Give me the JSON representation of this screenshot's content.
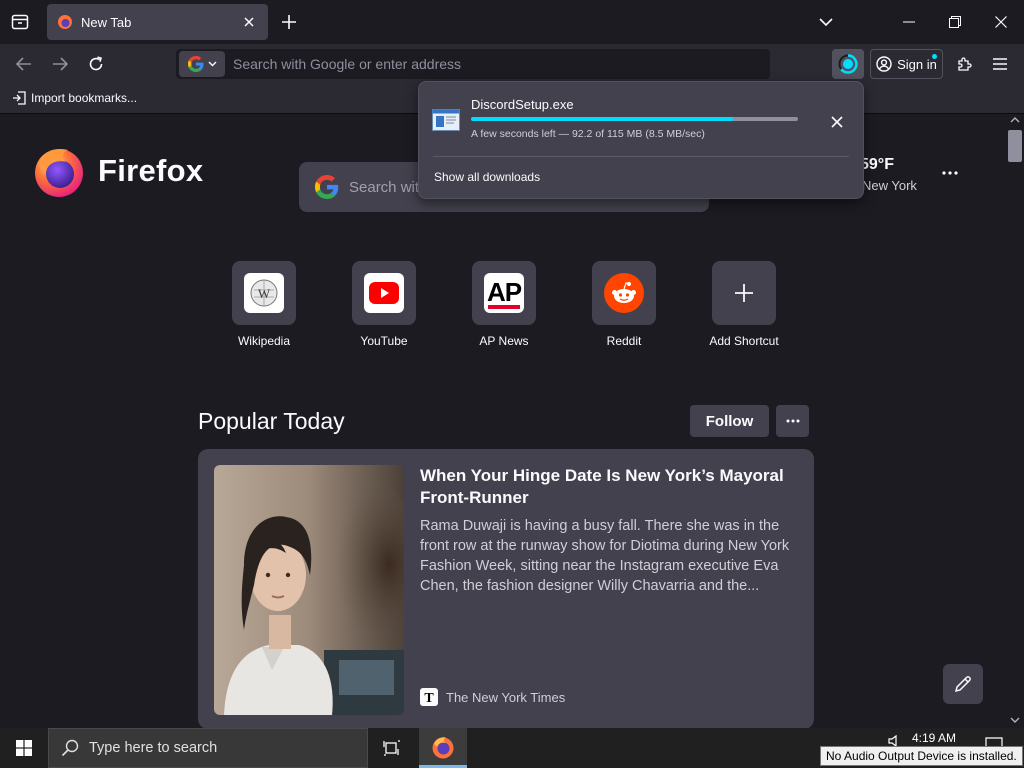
{
  "tab": {
    "title": "New Tab"
  },
  "urlbar": {
    "placeholder": "Search with Google or enter address"
  },
  "navbar": {
    "signin_label": "Sign in"
  },
  "bookmarks": {
    "import_label": "Import bookmarks..."
  },
  "logo": {
    "wordmark": "Firefox"
  },
  "search": {
    "placeholder": "Search wit"
  },
  "weather": {
    "temp": "59°F",
    "city": "New York"
  },
  "shortcuts": [
    {
      "label": "Wikipedia",
      "icon": "wikipedia-icon"
    },
    {
      "label": "YouTube",
      "icon": "youtube-icon"
    },
    {
      "label": "AP News",
      "icon": "ap-news-icon"
    },
    {
      "label": "Reddit",
      "icon": "reddit-icon"
    },
    {
      "label": "Add Shortcut",
      "icon": "plus-icon"
    }
  ],
  "popular": {
    "heading": "Popular Today",
    "follow_label": "Follow"
  },
  "card": {
    "title": "When Your Hinge Date Is New York’s Mayoral Front-Runner",
    "excerpt": "Rama Duwaji is having a busy fall. There she was in the front row at the runway show for Diotima during New York Fashion Week, sitting near the Instagram executive Eva Chen, the fashion designer Willy Chavarria and the...",
    "source": "The New York Times"
  },
  "download": {
    "filename": "DiscordSetup.exe",
    "status": "A few seconds left — 92.2 of 115 MB (8.5 MB/sec)",
    "progress": 0.8,
    "show_all_label": "Show all downloads"
  },
  "taskbar": {
    "search_placeholder": "Type here to search",
    "time": "4:19 AM",
    "tooltip": "No Audio Output Device is installed."
  },
  "colors": {
    "accent": "#00ddff",
    "background": "#1c1b22",
    "toolbar": "#2b2a33",
    "surface": "#42414d"
  }
}
